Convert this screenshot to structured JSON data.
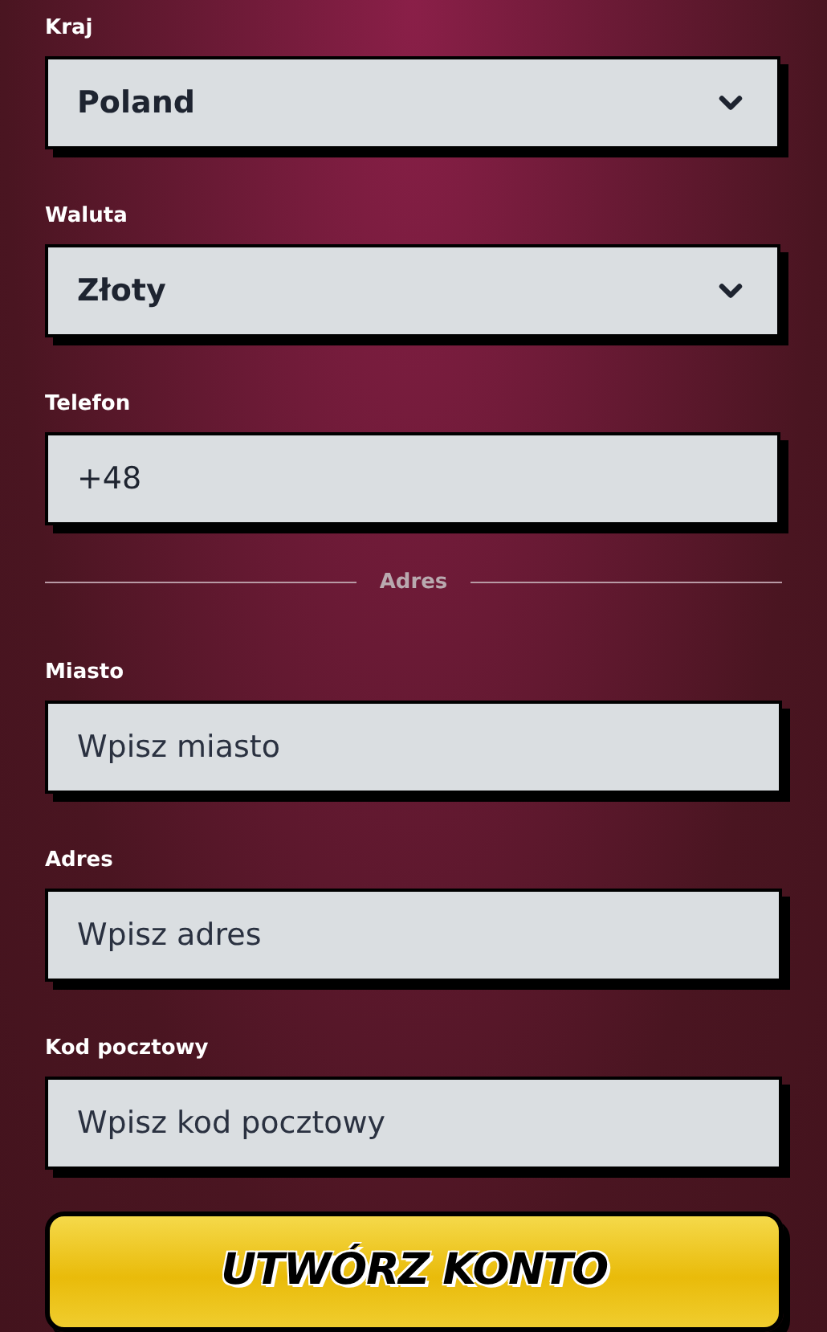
{
  "fields_top": [
    {
      "label": "Kraj",
      "kind": "select",
      "value": "Poland"
    },
    {
      "label": "Waluta",
      "kind": "select",
      "value": "Złoty"
    },
    {
      "label": "Telefon",
      "kind": "input",
      "value": "+48"
    }
  ],
  "divider": "Adres",
  "fields_address": [
    {
      "label": "Miasto",
      "kind": "input",
      "placeholder": "Wpisz miasto"
    },
    {
      "label": "Adres",
      "kind": "input",
      "placeholder": "Wpisz adres"
    },
    {
      "label": "Kod pocztowy",
      "kind": "input",
      "placeholder": "Wpisz kod pocztowy"
    }
  ],
  "submit_button": "UTWÓRZ KONTO"
}
